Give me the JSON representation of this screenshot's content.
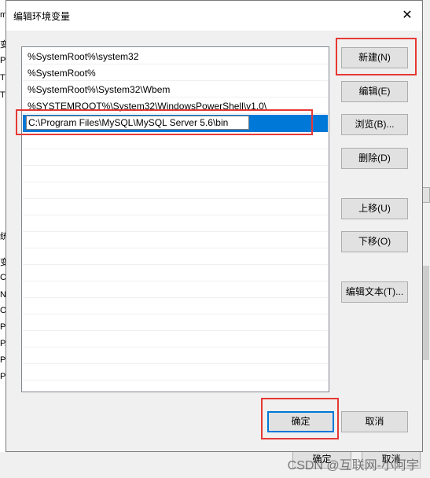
{
  "background": {
    "left_fragments": [
      "m",
      "变",
      "Pa",
      "TE",
      "TM",
      "统",
      "变",
      "Co",
      "N",
      "O",
      "Pa",
      "PA",
      "PF",
      "PF"
    ],
    "buttons": [
      "确定",
      "取消"
    ]
  },
  "dialog": {
    "title": "编辑环境变量",
    "paths": [
      "%SystemRoot%\\system32",
      "%SystemRoot%",
      "%SystemRoot%\\System32\\Wbem",
      "%SYSTEMROOT%\\System32\\WindowsPowerShell\\v1.0\\"
    ],
    "editing_value": "C:\\Program Files\\MySQL\\MySQL Server 5.6\\bin",
    "buttons": {
      "new": "新建(N)",
      "edit": "编辑(E)",
      "browse": "浏览(B)...",
      "delete": "删除(D)",
      "move_up": "上移(U)",
      "move_down": "下移(O)",
      "edit_text": "编辑文本(T)...",
      "ok": "确定",
      "cancel": "取消"
    }
  },
  "watermark": "CSDN @互联网-小阿宇",
  "colors": {
    "selection": "#0078d7",
    "highlight": "#e53935"
  }
}
